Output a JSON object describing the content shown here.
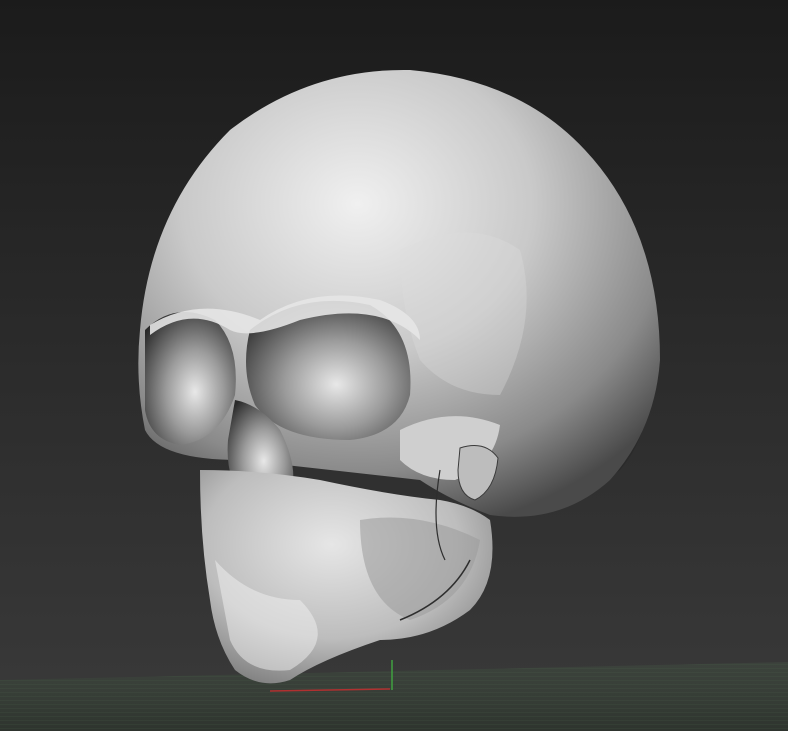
{
  "scene": {
    "subject": "skull-sculpt",
    "background_color_top": "#1b1b1b",
    "background_color_bottom": "#3a3a3a",
    "floor_grid_color": "#4f6b4f",
    "x_axis_color": "#b03030",
    "y_axis_color": "#40a040",
    "material_base": "#d0d0d0",
    "material_shadow": "#2a2a2a"
  }
}
